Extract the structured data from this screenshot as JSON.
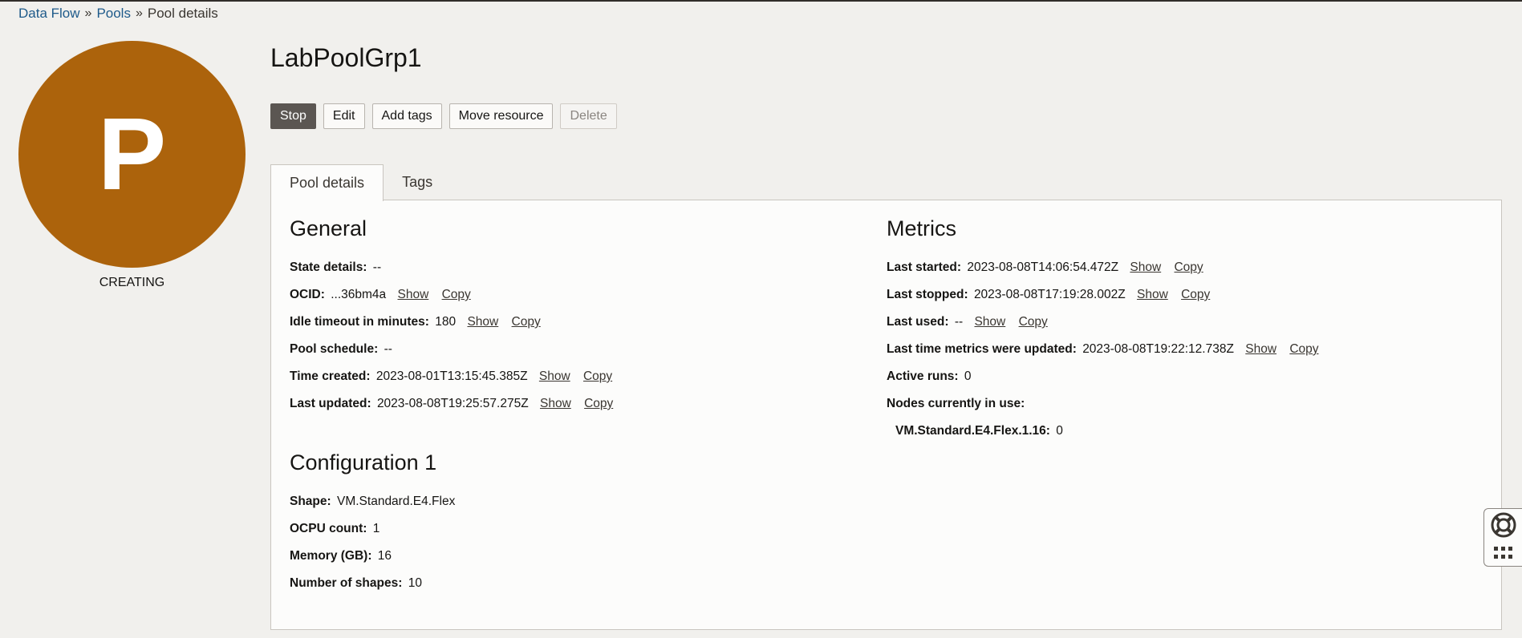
{
  "breadcrumb": {
    "items": [
      "Data Flow",
      "Pools"
    ],
    "current": "Pool details",
    "separator": "»"
  },
  "avatar": {
    "letter": "P",
    "color": "#ac630c"
  },
  "status": "CREATING",
  "title": "LabPoolGrp1",
  "actions": {
    "stop": "Stop",
    "edit": "Edit",
    "add_tags": "Add tags",
    "move_resource": "Move resource",
    "delete": "Delete"
  },
  "tabs": [
    "Pool details",
    "Tags"
  ],
  "general": {
    "heading": "General",
    "rows": [
      {
        "label": "State details:",
        "value": "--"
      },
      {
        "label": "OCID:",
        "value": "...36bm4a",
        "show": "Show",
        "copy": "Copy"
      },
      {
        "label": "Idle timeout in minutes:",
        "value": "180",
        "show": "Show",
        "copy": "Copy"
      },
      {
        "label": "Pool schedule:",
        "value": "--"
      },
      {
        "label": "Time created:",
        "value": "2023-08-01T13:15:45.385Z",
        "show": "Show",
        "copy": "Copy"
      },
      {
        "label": "Last updated:",
        "value": "2023-08-08T19:25:57.275Z",
        "show": "Show",
        "copy": "Copy"
      }
    ]
  },
  "metrics": {
    "heading": "Metrics",
    "rows": [
      {
        "label": "Last started:",
        "value": "2023-08-08T14:06:54.472Z",
        "show": "Show",
        "copy": "Copy"
      },
      {
        "label": "Last stopped:",
        "value": "2023-08-08T17:19:28.002Z",
        "show": "Show",
        "copy": "Copy"
      },
      {
        "label": "Last used:",
        "value": "--",
        "show": "Show",
        "copy": "Copy"
      },
      {
        "label": "Last time metrics were updated:",
        "value": "2023-08-08T19:22:12.738Z",
        "show": "Show",
        "copy": "Copy"
      },
      {
        "label": "Active runs:",
        "value": "0"
      },
      {
        "label": "Nodes currently in use:",
        "value": ""
      }
    ],
    "nodes": {
      "label": "VM.Standard.E4.Flex.1.16:",
      "value": "0"
    }
  },
  "configuration": {
    "heading": "Configuration 1",
    "rows": [
      {
        "label": "Shape:",
        "value": "VM.Standard.E4.Flex"
      },
      {
        "label": "OCPU count:",
        "value": "1"
      },
      {
        "label": "Memory (GB):",
        "value": "16"
      },
      {
        "label": "Number of shapes:",
        "value": "10"
      }
    ]
  },
  "help_widget": {
    "icons": [
      "lifebuoy-icon",
      "grid-icon"
    ]
  }
}
